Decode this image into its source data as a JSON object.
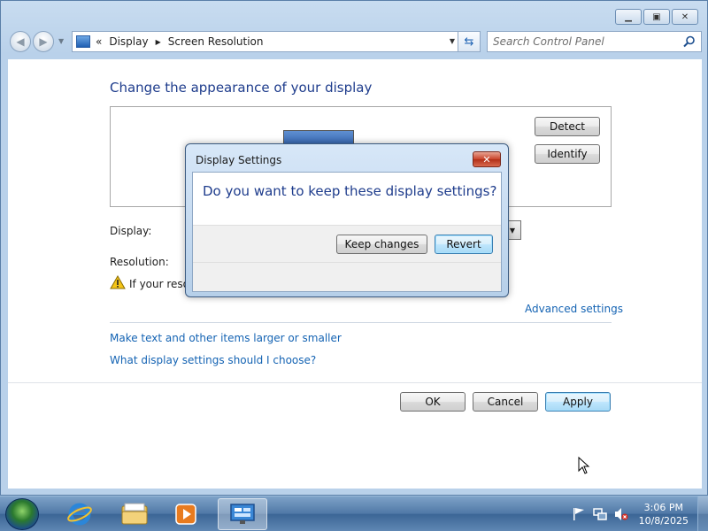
{
  "window": {
    "caption_buttons": [
      "minimize-icon",
      "restore-icon",
      "close-icon"
    ]
  },
  "navigation": {
    "back_icon": "back-arrow-icon",
    "forward_icon": "forward-arrow-icon",
    "address_prefix": "«",
    "breadcrumb": [
      "Display",
      "Screen Resolution"
    ],
    "search_placeholder": "Search Control Panel"
  },
  "main": {
    "heading": "Change the appearance of your display",
    "detect_label": "Detect",
    "identify_label": "Identify",
    "display_label": "Display:",
    "resolution_label": "Resolution:",
    "warning_text": "If your resol",
    "advanced_link": "Advanced settings",
    "link1": "Make text and other items larger or smaller",
    "link2": "What display settings should I choose?",
    "ok_label": "OK",
    "cancel_label": "Cancel",
    "apply_label": "Apply"
  },
  "dialog": {
    "title": "Display Settings",
    "close_icon": "close-icon",
    "question": "Do you want to keep these display settings?",
    "keep_label": "Keep changes",
    "revert_label": "Revert"
  },
  "taskbar": {
    "pinned": [
      "internet-explorer-icon",
      "folder-icon",
      "media-player-icon",
      "display-control-panel-icon"
    ],
    "tray_icons": [
      "flag-icon",
      "network-icon",
      "volume-muted-icon"
    ],
    "time": "3:06 PM",
    "date": "10/8/2025"
  },
  "colors": {
    "heading": "#1e3c8c",
    "link": "#1463b3",
    "taskbar": "#4f78a6"
  }
}
